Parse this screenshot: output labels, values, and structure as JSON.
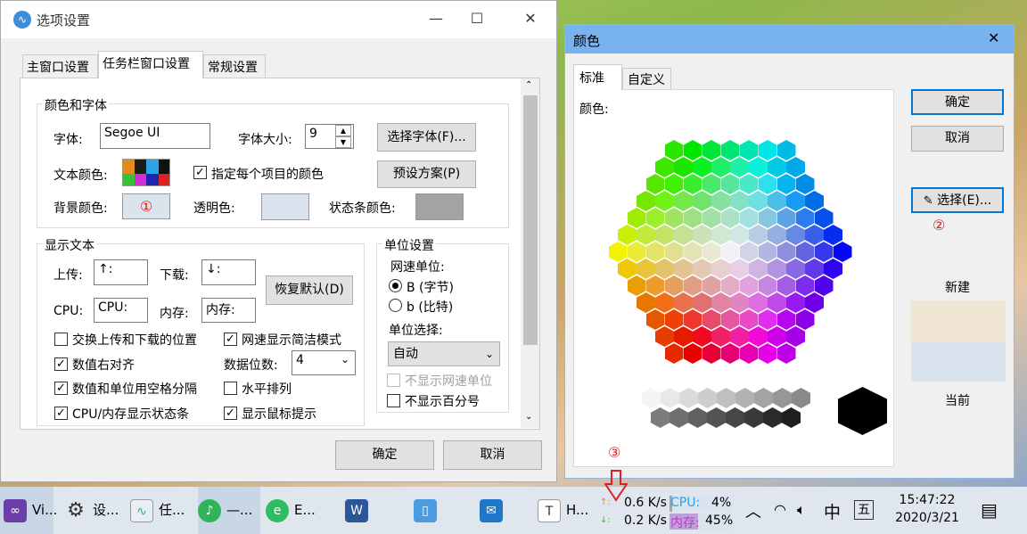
{
  "options_window": {
    "title": "选项设置",
    "minimize": "—",
    "maximize": "☐",
    "close": "✕",
    "tabs": [
      "主窗口设置",
      "任务栏窗口设置",
      "常规设置"
    ],
    "color_font_group": {
      "title": "颜色和字体",
      "font_label": "字体:",
      "font_value": "Segoe UI",
      "font_size_label": "字体大小:",
      "font_size_value": "9",
      "choose_font_button": "选择字体(F)...",
      "text_color_label": "文本颜色:",
      "per_item_color_label": "指定每个项目的颜色",
      "preset_button": "预设方案(P)",
      "bg_color_label": "背景颜色:",
      "bg_marker": "①",
      "transparent_label": "透明色:",
      "statusbar_color_label": "状态条颜色:",
      "bg_color": "#dae3ee",
      "transparent_color": "#dae3ee",
      "statusbar_color": "#a3a3a3"
    },
    "display_text_group": {
      "title": "显示文本",
      "upload_label": "上传:",
      "upload_value": "↑:",
      "download_label": "下载:",
      "download_value": "↓:",
      "restore_default_button": "恢复默认(D)",
      "cpu_label": "CPU:",
      "cpu_value": "CPU:",
      "memory_label": "内存:",
      "memory_value": "内存:",
      "swap_updown": "交换上传和下载的位置",
      "simple_mode": "网速显示简洁模式",
      "align_right": "数值右对齐",
      "digits_label": "数据位数:",
      "digits_value": "4",
      "space_separate": "数值和单位用空格分隔",
      "horizontal": "水平排列",
      "cpu_mem_statusbar": "CPU/内存显示状态条",
      "mouse_tooltip": "显示鼠标提示"
    },
    "unit_group": {
      "title": "单位设置",
      "speed_unit_label": "网速单位:",
      "unit_byte": "B (字节)",
      "unit_bit": "b (比特)",
      "unit_select_label": "单位选择:",
      "unit_select_value": "自动",
      "hide_speed_unit": "不显示网速单位",
      "hide_percent": "不显示百分号"
    },
    "ok_button": "确定",
    "cancel_button": "取消"
  },
  "color_dialog": {
    "title": "颜色",
    "close": "✕",
    "tabs": [
      "标准",
      "自定义"
    ],
    "colors_label": "颜色:",
    "ok_button": "确定",
    "cancel_button": "取消",
    "pick_button": "选择(E)...",
    "pick_marker": "②",
    "new_label": "新建",
    "current_label": "当前",
    "new_color": "#f1e6d5",
    "current_color": "#dae3ee"
  },
  "taskbar": {
    "apps": [
      {
        "label": "Vi...",
        "icon": "visual-studio-icon"
      },
      {
        "label": "设...",
        "icon": "gear-icon"
      },
      {
        "label": "任...",
        "icon": "task-manager-icon"
      },
      {
        "label": "—...",
        "icon": "music-icon"
      },
      {
        "label": "E...",
        "icon": "evernote-icon"
      },
      {
        "label": "",
        "icon": "word-icon"
      },
      {
        "label": "",
        "icon": "app-icon"
      },
      {
        "label": "",
        "icon": "mail-icon"
      },
      {
        "label": "H...",
        "icon": "typora-icon"
      }
    ],
    "marker": "③",
    "up_arrow": "↑:",
    "down_arrow": "↓:",
    "upload_speed": "0.6 K/s",
    "download_speed": "0.2 K/s",
    "cpu_label": "CPU:",
    "cpu_value": "4%",
    "cpu_percent": 4,
    "mem_label": "内存:",
    "mem_value": "45%",
    "mem_percent": 45,
    "ime": "中",
    "ime_mode": "五",
    "time": "15:47:22",
    "date": "2020/3/21"
  }
}
